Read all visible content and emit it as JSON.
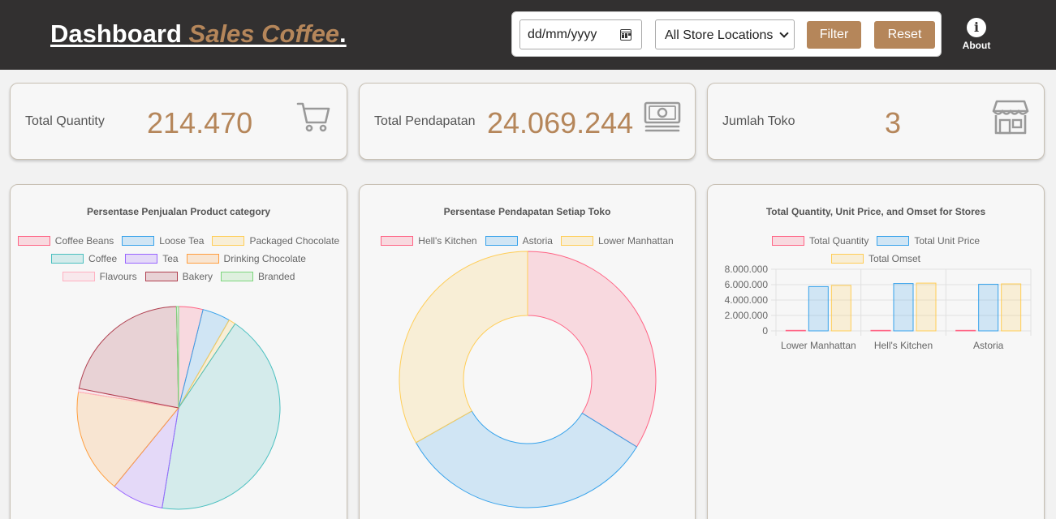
{
  "header": {
    "title_main": "Dashboard ",
    "title_accent": "Sales Coffee",
    "title_dot": ".",
    "date_placeholder": "dd/mm/yyyy",
    "location_select": "All Store Locations",
    "filter_label": "Filter",
    "reset_label": "Reset",
    "about_label": "About",
    "accent_color": "#b5865a",
    "bg_color": "#323030"
  },
  "stats": [
    {
      "label": "Total Quantity",
      "value": "214.470",
      "icon": "cart-icon"
    },
    {
      "label": "Total Pendapatan",
      "value": "24.069.244",
      "icon": "money-icon"
    },
    {
      "label": "Jumlah Toko",
      "value": "3",
      "icon": "store-icon"
    }
  ],
  "chart_data": [
    {
      "type": "pie",
      "title": "Persentase Penjualan Product category",
      "categories": [
        "Coffee Beans",
        "Loose Tea",
        "Packaged Chocolate",
        "Coffee",
        "Tea",
        "Drinking Chocolate",
        "Flavours",
        "Bakery",
        "Branded"
      ],
      "values": [
        3.5,
        4.0,
        1.0,
        39.0,
        7.5,
        15.0,
        0.5,
        19.5,
        0.3
      ],
      "colors": [
        "#ff6384",
        "#36a2eb",
        "#ffcd56",
        "#4bc0c0",
        "#9966ff",
        "#ff9f40",
        "#ffb1c1",
        "#b04050",
        "#7ed67e"
      ],
      "legend": "top"
    },
    {
      "type": "doughnut",
      "title": "Persentase Pendapatan Setiap Toko",
      "categories": [
        "Hell's Kitchen",
        "Astoria",
        "Lower Manhattan"
      ],
      "values": [
        33.8,
        33.0,
        33.2
      ],
      "colors": [
        "#ff6384",
        "#36a2eb",
        "#ffcd56"
      ],
      "legend": "top"
    },
    {
      "type": "bar",
      "title": "Total Quantity, Unit Price, and Omset for Stores",
      "categories": [
        "Lower Manhattan",
        "Hell's Kitchen",
        "Astoria"
      ],
      "series": [
        {
          "name": "Total Quantity",
          "values": [
            71742,
            71737,
            70991
          ],
          "color": "#ff6384"
        },
        {
          "name": "Total Unit Price",
          "values": [
            5750000,
            6150000,
            6050000
          ],
          "color": "#36a2eb"
        },
        {
          "name": "Total Omset",
          "values": [
            5900000,
            6200000,
            6100000
          ],
          "color": "#ffcd56"
        }
      ],
      "yticks": [
        "8.000.000",
        "6.000.000",
        "4.000.000",
        "2.000.000",
        "0"
      ],
      "ylim": [
        0,
        8000000
      ],
      "grid": true,
      "legend": "top"
    }
  ]
}
